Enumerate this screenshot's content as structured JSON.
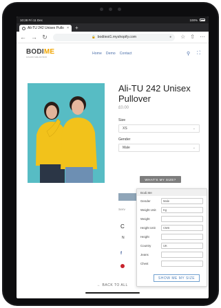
{
  "status": {
    "time": "10:28",
    "date": "Fri 11 Dec",
    "battery": "100%"
  },
  "browser": {
    "tab_title": "Ali-TU 242 Unisex Pullo",
    "tab_close": "×",
    "new_tab": "+",
    "url": "bodiiest1.myshopify.com",
    "back": "←",
    "forward": "→",
    "reload": "↻"
  },
  "store": {
    "logo_main": "BODI",
    "logo_accent": "ME",
    "logo_tagline": "FASHION SIZE ADVISOR",
    "nav": [
      "Home",
      "Demo",
      "Contact"
    ]
  },
  "product": {
    "title": "Ali-TU 242 Unisex Pullover",
    "price": "£0.00",
    "size_label": "Size",
    "size_value": "XS",
    "gender_label": "Gender",
    "gender_value": "Male",
    "whats_my_size": "WHAT'S MY SIZE?",
    "serv_text": "Serv",
    "c_text": "C",
    "n_text": "N",
    "link_text": "re"
  },
  "popup": {
    "header": "Bodi.Me",
    "fields": [
      {
        "label": "Gender",
        "value": "Male"
      },
      {
        "label": "Weight Unit",
        "value": "Kg"
      },
      {
        "label": "Weight",
        "value": ""
      },
      {
        "label": "Height Unit",
        "value": "CMS"
      },
      {
        "label": "Height",
        "value": ""
      },
      {
        "label": "Country",
        "value": "UK"
      },
      {
        "label": "Jeans",
        "value": ""
      },
      {
        "label": "Chest",
        "value": ""
      }
    ],
    "submit": "SHOW ME MY SIZE"
  },
  "footer": {
    "back_to_all": "← BACK TO ALL"
  },
  "colors": {
    "accent_link": "#4a6ea9",
    "photo_bg": "#57bcc4",
    "sweater": "#f2c21b",
    "button_grey": "#7d7d7d"
  }
}
